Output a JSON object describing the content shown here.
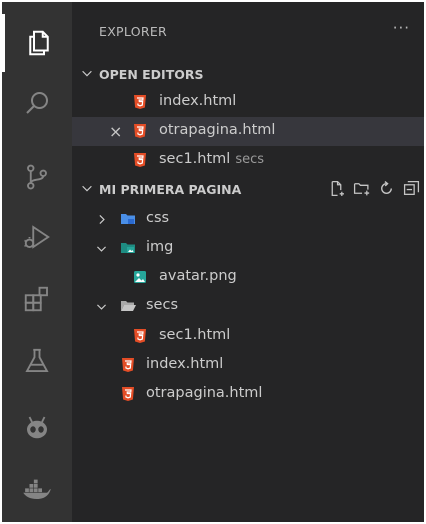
{
  "activity_bar": {
    "items": [
      {
        "icon": "files-icon",
        "active": true
      },
      {
        "icon": "search-icon"
      },
      {
        "icon": "source-control-icon"
      },
      {
        "icon": "run-debug-icon"
      },
      {
        "icon": "extensions-icon"
      },
      {
        "icon": "testing-flask-icon"
      },
      {
        "icon": "alien-extension-icon"
      },
      {
        "icon": "docker-whale-icon"
      }
    ]
  },
  "explorer": {
    "title": "EXPLORER",
    "more": "···"
  },
  "open_editors": {
    "label": "OPEN EDITORS",
    "items": [
      {
        "name": "index.html",
        "description": ""
      },
      {
        "name": "otrapagina.html",
        "description": "",
        "close": "×"
      },
      {
        "name": "sec1.html",
        "description": "secs"
      }
    ]
  },
  "workspace": {
    "label": "MI PRIMERA PAGINA",
    "tree": [
      {
        "name": "css",
        "type": "folder",
        "expanded": false
      },
      {
        "name": "img",
        "type": "folder",
        "expanded": true
      },
      {
        "name": "avatar.png",
        "type": "image"
      },
      {
        "name": "secs",
        "type": "folder",
        "expanded": true
      },
      {
        "name": "sec1.html",
        "type": "html"
      },
      {
        "name": "index.html",
        "type": "html"
      },
      {
        "name": "otrapagina.html",
        "type": "html"
      }
    ]
  },
  "colors": {
    "html_icon": "#e44d26",
    "css_folder": "#4a8fe7",
    "img_folder": "#26a69a",
    "image_file": "#26a69a",
    "folder": "#c5c5c5"
  }
}
